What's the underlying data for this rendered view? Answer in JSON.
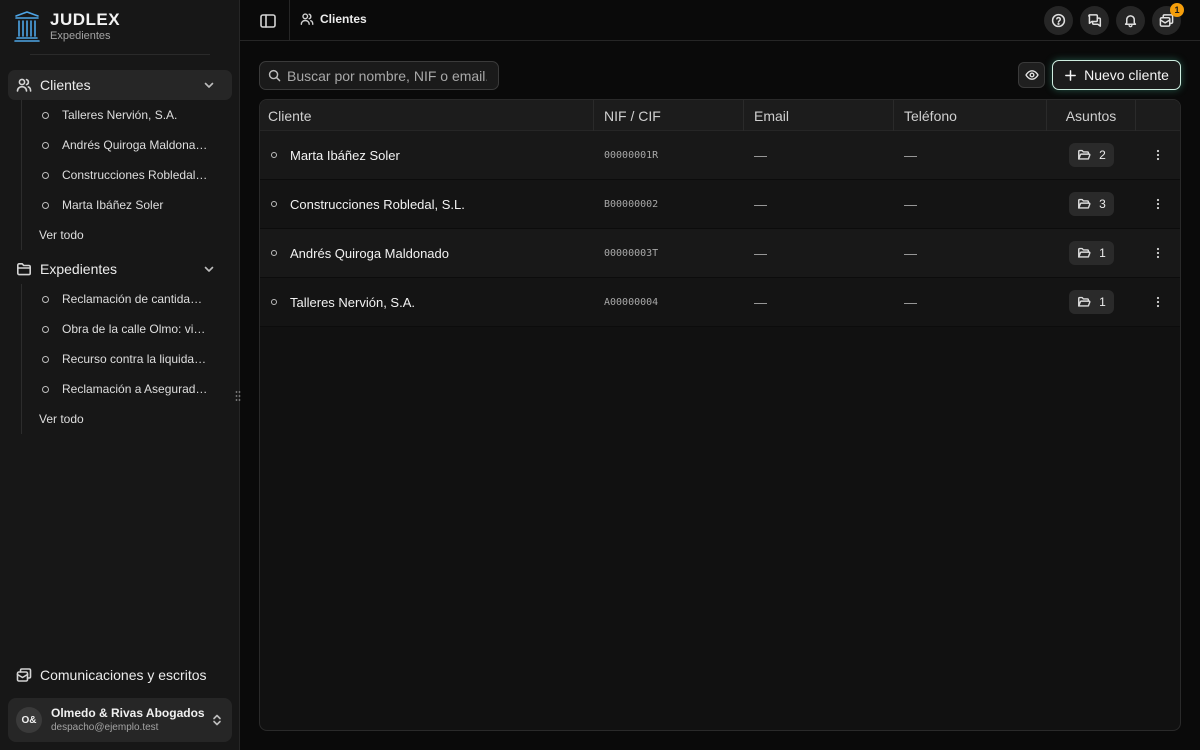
{
  "brand": {
    "name": "JUDLEX",
    "subtitle": "Expedientes"
  },
  "sidebar": {
    "groups": [
      {
        "label": "Clientes",
        "items": [
          "Talleres Nervión, S.A.",
          "Andrés Quiroga Maldonado",
          "Construcciones Robledal, S.L.",
          "Marta Ibáñez Soler"
        ],
        "see_all": "Ver todo"
      },
      {
        "label": "Expedientes",
        "items": [
          "Reclamación de cantidad por impago",
          "Obra de la calle Olmo: vicios ocultos",
          "Recurso contra la liquidación",
          "Reclamación a Aseguradora"
        ],
        "see_all": "Ver todo"
      }
    ],
    "communications": "Comunicaciones y escritos",
    "account": {
      "initials": "O&",
      "name": "Olmedo & Rivas Abogados",
      "email": "despacho@ejemplo.test"
    }
  },
  "topbar": {
    "breadcrumb": "Clientes",
    "notification_count": "1"
  },
  "search": {
    "placeholder": "Buscar por nombre, NIF o email."
  },
  "actions": {
    "new_client": "Nuevo cliente"
  },
  "table": {
    "columns": [
      "Cliente",
      "NIF / CIF",
      "Email",
      "Teléfono",
      "Asuntos"
    ],
    "rows": [
      {
        "name": "Marta Ibáñez Soler",
        "nif": "00000001R",
        "email": "—",
        "phone": "—",
        "cases": "2"
      },
      {
        "name": "Construcciones Robledal, S.L.",
        "nif": "B00000002",
        "email": "—",
        "phone": "—",
        "cases": "3"
      },
      {
        "name": "Andrés Quiroga Maldonado",
        "nif": "00000003T",
        "email": "—",
        "phone": "—",
        "cases": "1"
      },
      {
        "name": "Talleres Nervión, S.A.",
        "nif": "A00000004",
        "email": "—",
        "phone": "—",
        "cases": "1"
      }
    ]
  },
  "colors": {
    "accent_badge": "#f59e0b",
    "logo": "#4ea5e6",
    "new_button_glow": "#cfeee0"
  }
}
